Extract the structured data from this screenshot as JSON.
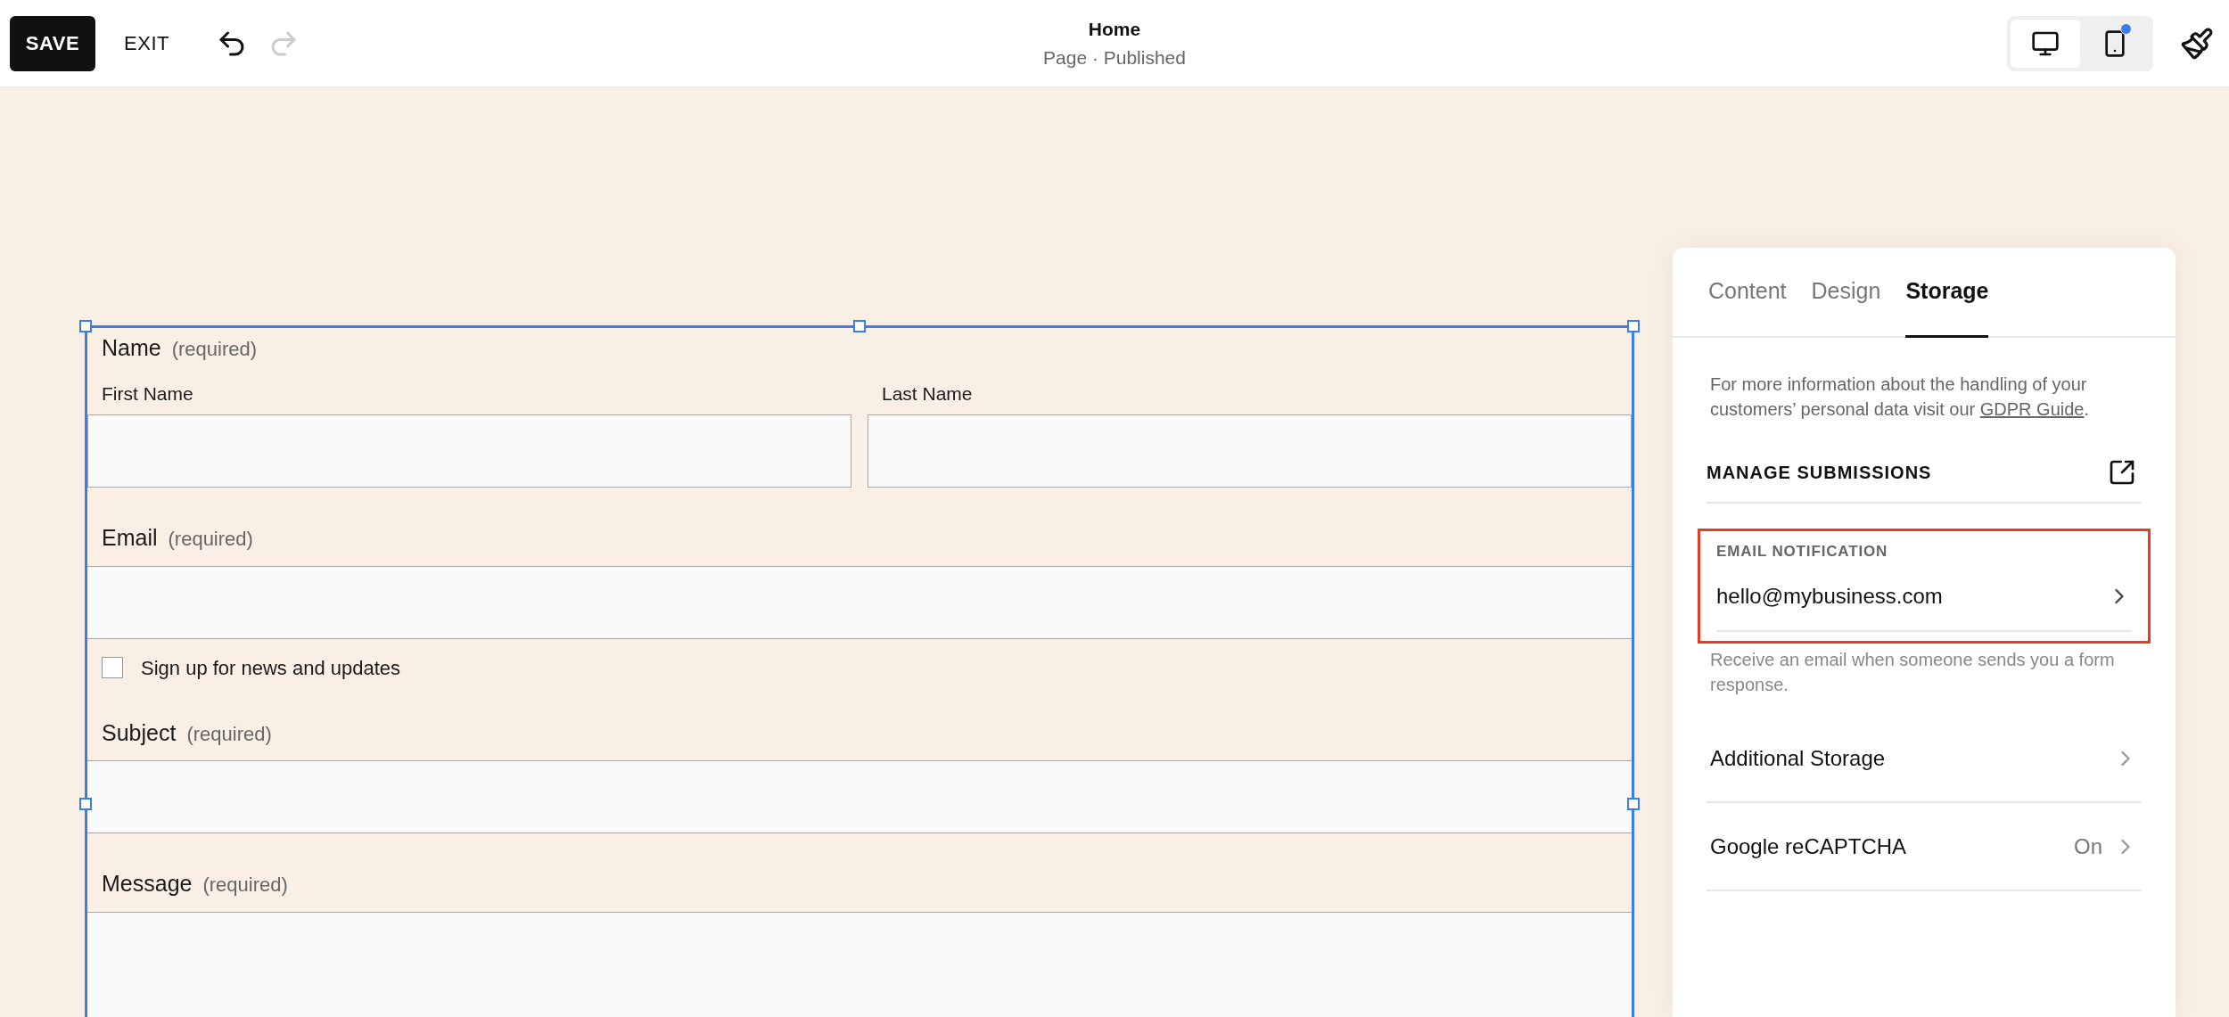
{
  "toolbar": {
    "save": "SAVE",
    "exit": "EXIT",
    "undo": {
      "disabled": false
    },
    "redo": {
      "disabled": true
    }
  },
  "header": {
    "title": "Home",
    "subtitle": "Page · Published"
  },
  "view_toggle": [
    {
      "kind": "desktop",
      "selected": true,
      "indicator": false
    },
    {
      "kind": "mobile",
      "selected": false,
      "indicator": true
    }
  ],
  "form": {
    "fields": [
      {
        "kind": "name",
        "label": "Name",
        "note": "(required)",
        "parts": [
          "First Name",
          "Last Name"
        ]
      },
      {
        "kind": "text",
        "label": "Email",
        "note": "(required)",
        "checkbox": {
          "label": "Sign up for news and updates",
          "checked": false
        }
      },
      {
        "kind": "text",
        "label": "Subject",
        "note": "(required)"
      },
      {
        "kind": "textarea",
        "label": "Message",
        "note": "(required)"
      }
    ]
  },
  "panel": {
    "tabs": [
      {
        "label": "Content",
        "selected": false
      },
      {
        "label": "Design",
        "selected": false
      },
      {
        "label": "Storage",
        "selected": true
      }
    ],
    "info": {
      "text": "For more information about the handling of your customers’ personal data visit our",
      "link": "GDPR Guide",
      "tail": "."
    },
    "manage": "MANAGE SUBMISSIONS",
    "email_notification": {
      "heading": "EMAIL NOTIFICATION",
      "value": "hello@mybusiness.com",
      "highlighted": true,
      "help": "Receive an email when someone sends you a form response."
    },
    "rows": [
      {
        "label": "Additional Storage"
      },
      {
        "label": "Google reCAPTCHA",
        "value": "On"
      }
    ]
  }
}
